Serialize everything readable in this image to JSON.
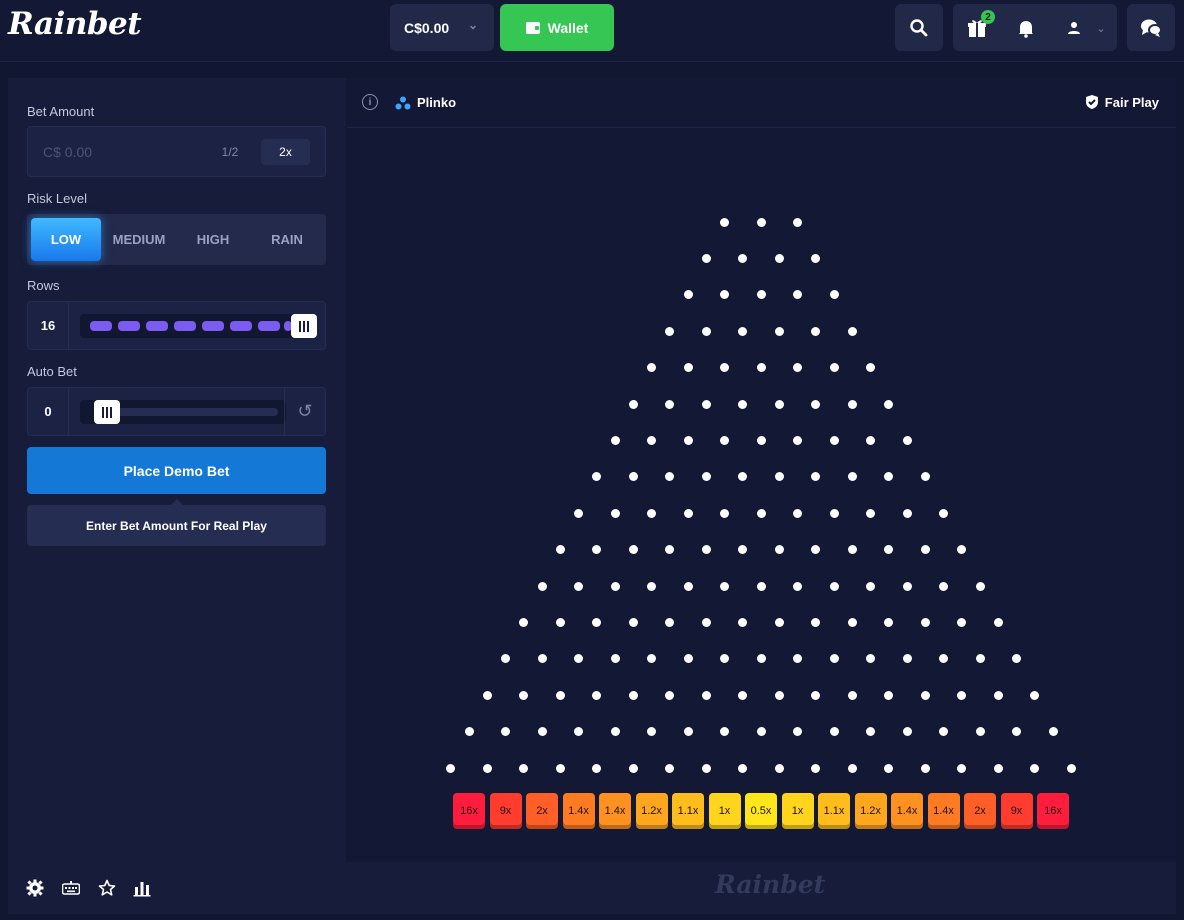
{
  "brand": {
    "logo": "Rainbet",
    "watermark": "Rainbet"
  },
  "header": {
    "balance": "C$0.00",
    "wallet_label": "Wallet",
    "gift_badge": "2"
  },
  "controls": {
    "bet_amount_label": "Bet Amount",
    "bet_placeholder": "C$ 0.00",
    "half_label": "1/2",
    "double_label": "2x",
    "risk_label": "Risk Level",
    "risk_options": [
      "LOW",
      "MEDIUM",
      "HIGH",
      "RAIN"
    ],
    "risk_selected": "LOW",
    "rows_label": "Rows",
    "rows_value": "16",
    "rows_fraction": 1.0,
    "auto_bet_label": "Auto Bet",
    "auto_bet_value": "0",
    "auto_bet_fraction": 0.0,
    "place_bet_label": "Place Demo Bet",
    "hint": "Enter Bet Amount For Real Play"
  },
  "game": {
    "title": "Plinko",
    "fair_play": "Fair Play",
    "rows": 16,
    "multipliers": [
      "16x",
      "9x",
      "2x",
      "1.4x",
      "1.4x",
      "1.2x",
      "1.1x",
      "1x",
      "0.5x",
      "1x",
      "1.1x",
      "1.2x",
      "1.4x",
      "1.4x",
      "2x",
      "9x",
      "16x"
    ],
    "bucket_colors": [
      "#ff1c3d",
      "#ff3c2e",
      "#ff5f26",
      "#ff7b22",
      "#ff9120",
      "#ffa61f",
      "#ffbd1d",
      "#ffd41c",
      "#ffe61b",
      "#ffd41c",
      "#ffbd1d",
      "#ffa61f",
      "#ff9120",
      "#ff7b22",
      "#ff5f26",
      "#ff3c2e",
      "#ff1c3d"
    ]
  },
  "colors": {
    "accent_blue": "#1478d6",
    "wallet_green": "#35c653",
    "slider_purple": "#7b5cf0"
  },
  "icons": {
    "search": "search-icon",
    "gift": "gift-icon",
    "bell": "bell-icon",
    "user": "user-icon",
    "chat": "chat-icon",
    "settings": "gear-icon",
    "keyboard": "keyboard-icon",
    "favorite": "star-icon",
    "stats": "bar-chart-icon"
  }
}
